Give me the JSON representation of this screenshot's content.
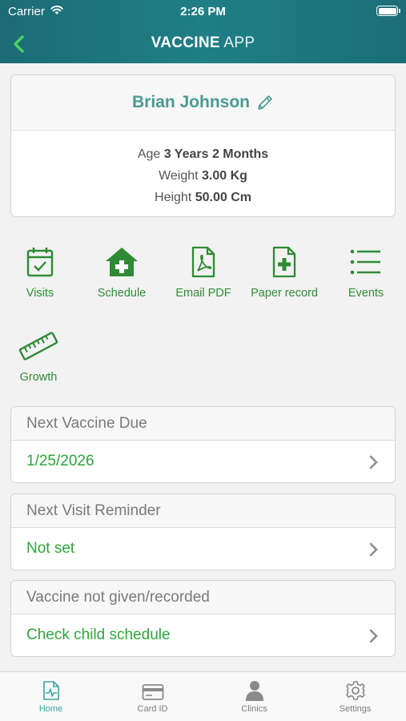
{
  "status": {
    "carrier": "Carrier",
    "time": "2:26 PM"
  },
  "nav": {
    "title_bold": "VACCINE",
    "title_light": " APP"
  },
  "profile": {
    "name": "Brian Johnson",
    "age_label": "Age ",
    "age_value": "3 Years 2 Months",
    "weight_label": "Weight ",
    "weight_value": "3.00 Kg",
    "height_label": "Height ",
    "height_value": "50.00 Cm"
  },
  "actions": [
    {
      "label": "Visits",
      "icon": "calendar-check-icon"
    },
    {
      "label": "Schedule",
      "icon": "house-plus-icon"
    },
    {
      "label": "Email PDF",
      "icon": "pdf-file-icon"
    },
    {
      "label": "Paper record",
      "icon": "file-plus-icon"
    },
    {
      "label": "Events",
      "icon": "list-icon"
    },
    {
      "label": "Growth",
      "icon": "ruler-icon"
    }
  ],
  "sections": [
    {
      "header": "Next Vaccine Due",
      "value": "1/25/2026"
    },
    {
      "header": "Next Visit Reminder",
      "value": "Not set"
    },
    {
      "header": "Vaccine not given/recorded",
      "value": "Check child schedule"
    }
  ],
  "tabs": [
    {
      "label": "Home",
      "icon": "home-document-icon",
      "active": true
    },
    {
      "label": "Card ID",
      "icon": "id-card-icon",
      "active": false
    },
    {
      "label": "Clinics",
      "icon": "person-icon",
      "active": false
    },
    {
      "label": "Settings",
      "icon": "gear-icon",
      "active": false
    }
  ],
  "colors": {
    "header": "#1f7f86",
    "accent_green": "#2e8b34",
    "value_green": "#2fa53a",
    "name_teal": "#4a9a93",
    "active_tab": "#3aa6a0"
  }
}
